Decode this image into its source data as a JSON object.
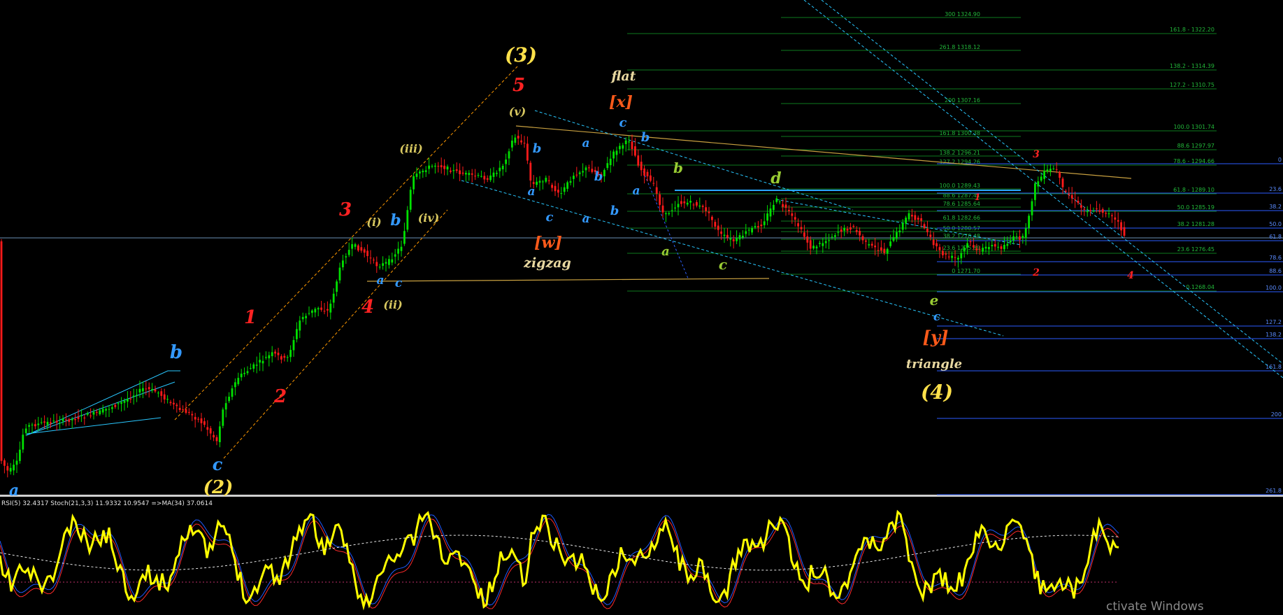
{
  "header": {
    "indicator_text": "RSI(5) 32.4317  Stoch(21,3,3) 11.9332 10.9547  =>MA(34) 37.0614"
  },
  "watermark": "ctivate Windows",
  "colors": {
    "background": "#000000",
    "bull_candle": "#00e000",
    "bear_candle": "#ff1a1a",
    "rsi_line": "#ffff00",
    "stoch_main": "#1e5bff",
    "stoch_signal": "#ff2a2a",
    "fib_green": "#0e7a1e",
    "fib_blue": "#2b5cff",
    "channel_orange": "#ff9900",
    "channel_cyan": "#29c7ff",
    "trend_tan": "#c8a040"
  },
  "chart_data": {
    "type": "candlestick",
    "series": [
      {
        "name": "RSI(5)",
        "value": 32.4317
      },
      {
        "name": "Stoch(21,3,3) main",
        "value": 11.9332
      },
      {
        "name": "Stoch(21,3,3) signal",
        "value": 10.9547
      },
      {
        "name": "MA(34)",
        "value": 37.0614
      }
    ],
    "fib_levels_top_green": [
      {
        "label": "300 1324.90",
        "price": 1324.9
      },
      {
        "label": "261.8 1318.12",
        "price": 1318.12
      },
      {
        "label": "200 1307.16",
        "price": 1307.16
      },
      {
        "label": "161.8 1300.38",
        "price": 1300.38
      },
      {
        "label": "138.2 1296.21",
        "price": 1296.21
      },
      {
        "label": "127.2 1294.26",
        "price": 1294.26
      },
      {
        "label": "100.0 1289.43",
        "price": 1289.43
      },
      {
        "label": "88.6 1287.41",
        "price": 1287.41
      },
      {
        "label": "78.6 1285.64",
        "price": 1285.64
      },
      {
        "label": "61.8 1282.66",
        "price": 1282.66
      },
      {
        "label": "50.0 1280.57",
        "price": 1280.57
      },
      {
        "label": "38.2 1278.48",
        "price": 1278.48
      },
      {
        "label": "23.6 1275.89",
        "price": 1275.89
      },
      {
        "label": "0 1271.70",
        "price": 1271.7
      }
    ],
    "fib_levels_right_green": [
      {
        "label": "161.8 - 1322.20",
        "price": 1322.2
      },
      {
        "label": "138.2 - 1314.39",
        "price": 1314.39
      },
      {
        "label": "127.2 - 1310.75",
        "price": 1310.75
      },
      {
        "label": "100.0 1301.74",
        "price": 1301.74
      },
      {
        "label": "88.6 1297.97",
        "price": 1297.97
      },
      {
        "label": "78.6 - 1294.66",
        "price": 1294.66
      },
      {
        "label": "61.8 - 1289.10",
        "price": 1289.1
      },
      {
        "label": "50.0 1285.19",
        "price": 1285.19
      },
      {
        "label": "38.2 1281.28",
        "price": 1281.28
      },
      {
        "label": "23.6 1276.45",
        "price": 1276.45
      },
      {
        "label": "0.1268.04",
        "price": 1268.04
      }
    ],
    "fib_levels_right_blue": [
      {
        "label": "0"
      },
      {
        "label": "23.6"
      },
      {
        "label": "38.2"
      },
      {
        "label": "50.0"
      },
      {
        "label": "61.8"
      },
      {
        "label": "78.6"
      },
      {
        "label": "88.6"
      },
      {
        "label": "100.0"
      },
      {
        "label": "127.2"
      },
      {
        "label": "138.2"
      },
      {
        "label": "161.8"
      },
      {
        "label": "200"
      },
      {
        "label": "261.8"
      }
    ],
    "wave_labels": [
      {
        "text": "(3)",
        "color": "#ffe14a"
      },
      {
        "text": "(2)",
        "color": "#ffe14a"
      },
      {
        "text": "(4)",
        "color": "#ffe14a"
      },
      {
        "text": "5",
        "color": "#ff2222"
      },
      {
        "text": "3",
        "color": "#ff2222"
      },
      {
        "text": "4",
        "color": "#ff2222"
      },
      {
        "text": "1",
        "color": "#ff2222"
      },
      {
        "text": "2",
        "color": "#ff2222"
      },
      {
        "text": "(v)",
        "color": "#d8c860"
      },
      {
        "text": "(iii)",
        "color": "#d8c860"
      },
      {
        "text": "(i)",
        "color": "#d8c860"
      },
      {
        "text": "(iv)",
        "color": "#d8c860"
      },
      {
        "text": "(ii)",
        "color": "#d8c860"
      },
      {
        "text": "flat",
        "color": "#e8d8a0"
      },
      {
        "text": "[x]",
        "color": "#ff5a1a"
      },
      {
        "text": "[w]",
        "color": "#ff5a1a"
      },
      {
        "text": "zigzag",
        "color": "#e8d8a0"
      },
      {
        "text": "[y]",
        "color": "#ff5a1a"
      },
      {
        "text": "triangle",
        "color": "#e8d8a0"
      },
      {
        "text": "a",
        "color": "#3399ff"
      },
      {
        "text": "b",
        "color": "#3399ff"
      },
      {
        "text": "c",
        "color": "#3399ff"
      },
      {
        "text": "a",
        "color": "#99cc33"
      },
      {
        "text": "b",
        "color": "#99cc33"
      },
      {
        "text": "c",
        "color": "#99cc33"
      },
      {
        "text": "d",
        "color": "#99cc33"
      },
      {
        "text": "e",
        "color": "#99cc33"
      }
    ]
  }
}
